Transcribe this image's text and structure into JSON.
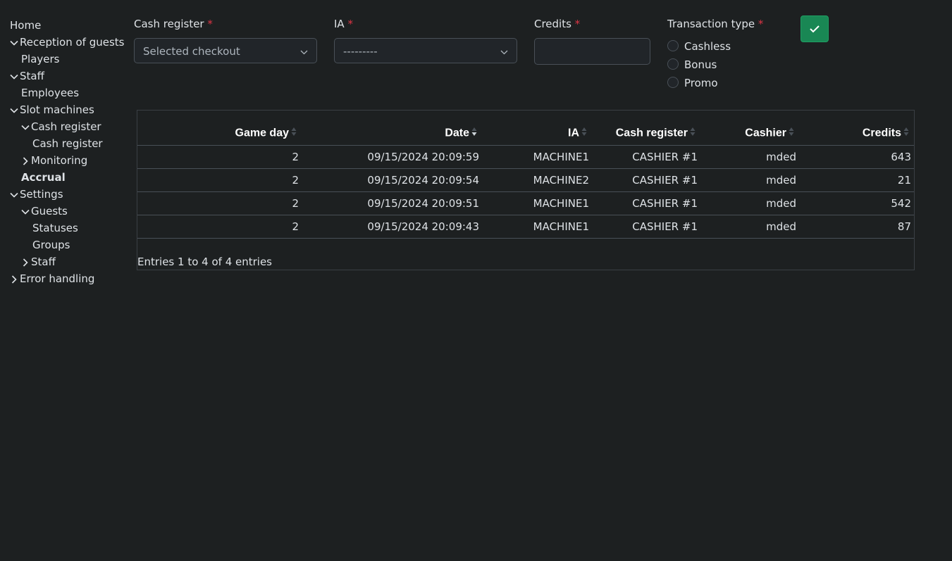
{
  "sidebar": {
    "home": "Home",
    "reception": "Reception of guests",
    "players": "Players",
    "staff": "Staff",
    "employees": "Employees",
    "slot_machines": "Slot machines",
    "cash_register_group": "Cash register",
    "cash_register_item": "Cash register",
    "monitoring": "Monitoring",
    "accrual": "Accrual",
    "settings": "Settings",
    "guests": "Guests",
    "statuses": "Statuses",
    "groups": "Groups",
    "settings_staff": "Staff",
    "error_handling": "Error handling"
  },
  "form": {
    "cash_register_label": "Cash register",
    "cash_register_placeholder": "Selected checkout",
    "ia_label": "IA",
    "ia_value": "---------",
    "credits_label": "Credits",
    "credits_value": "",
    "transaction_type_label": "Transaction type",
    "required_mark": "*",
    "radio_options": [
      "Cashless",
      "Bonus",
      "Promo"
    ]
  },
  "table": {
    "headers": [
      "Game day",
      "Date",
      "IA",
      "Cash register",
      "Cashier",
      "Credits"
    ],
    "rows": [
      [
        "2",
        "09/15/2024 20:09:59",
        "MACHINE1",
        "CASHIER #1",
        "mded",
        "643"
      ],
      [
        "2",
        "09/15/2024 20:09:54",
        "MACHINE2",
        "CASHIER #1",
        "mded",
        "21"
      ],
      [
        "2",
        "09/15/2024 20:09:51",
        "MACHINE1",
        "CASHIER #1",
        "mded",
        "542"
      ],
      [
        "2",
        "09/15/2024 20:09:43",
        "MACHINE1",
        "CASHIER #1",
        "mded",
        "87"
      ]
    ],
    "info": "Entries 1 to 4 of 4 entries"
  },
  "colors": {
    "background": "#1d2021",
    "accent": "#198754",
    "required": "#dc3545"
  }
}
